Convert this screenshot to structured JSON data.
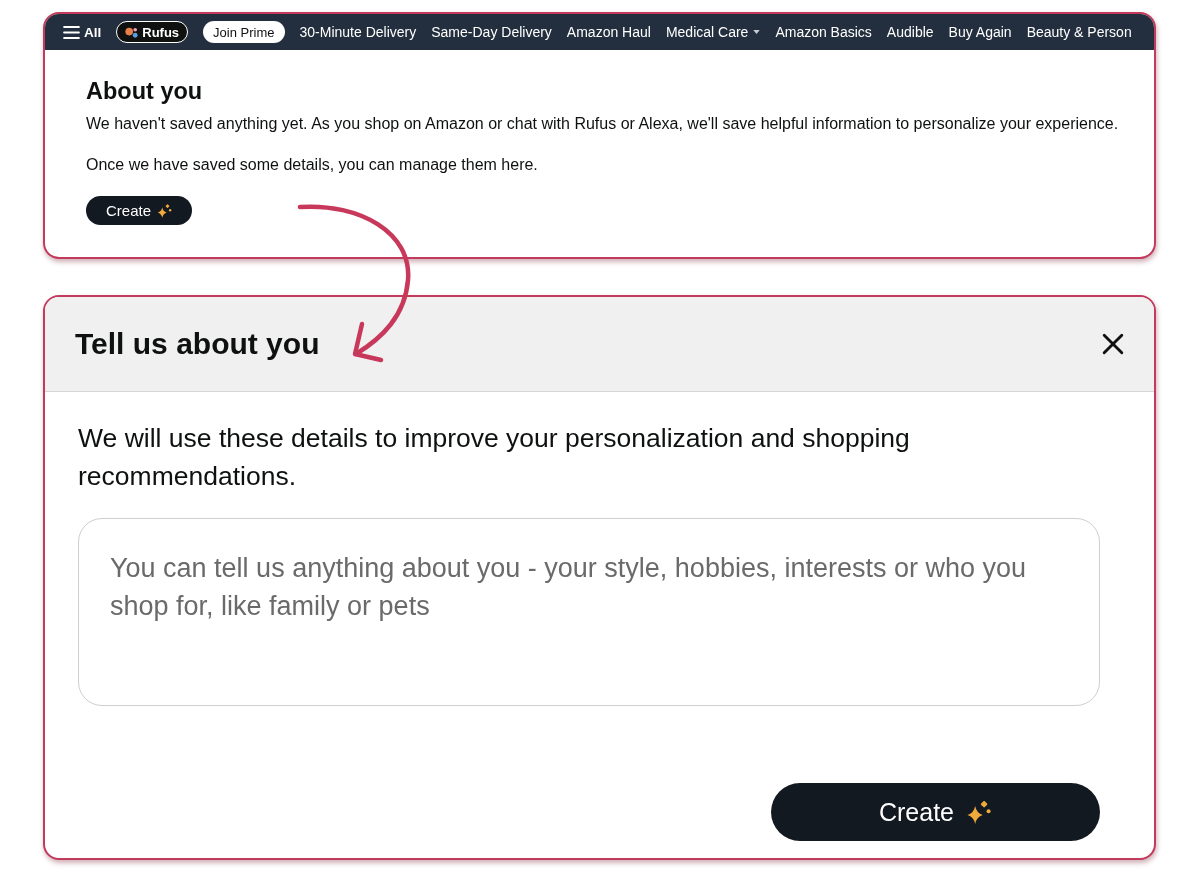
{
  "nav": {
    "items": [
      {
        "kind": "menu",
        "label": "All"
      },
      {
        "kind": "rufus",
        "label": "Rufus"
      },
      {
        "kind": "pill",
        "label": "Join Prime"
      },
      {
        "kind": "link",
        "label": "30-Minute Delivery"
      },
      {
        "kind": "link",
        "label": "Same-Day Delivery"
      },
      {
        "kind": "link",
        "label": "Amazon Haul"
      },
      {
        "kind": "dropdown",
        "label": "Medical Care"
      },
      {
        "kind": "link",
        "label": "Amazon Basics"
      },
      {
        "kind": "link",
        "label": "Audible"
      },
      {
        "kind": "link",
        "label": "Buy Again"
      },
      {
        "kind": "link",
        "label": "Beauty & Person"
      }
    ]
  },
  "about_card": {
    "title": "About you",
    "paragraphs": [
      "We haven't saved anything yet. As you shop on Amazon or chat with Rufus or Alexa, we'll save helpful information to personalize your experience.",
      "Once we have saved some details, you can manage them here."
    ],
    "button": {
      "label": "Create"
    }
  },
  "dialog": {
    "title": "Tell us about you",
    "description": "We will use these details to improve your personalization and shopping recommendations.",
    "input": {
      "placeholder": "You can tell us anything about you - your style, hobbies, interests or who you shop for, like family or pets"
    },
    "button": {
      "label": "Create"
    }
  }
}
